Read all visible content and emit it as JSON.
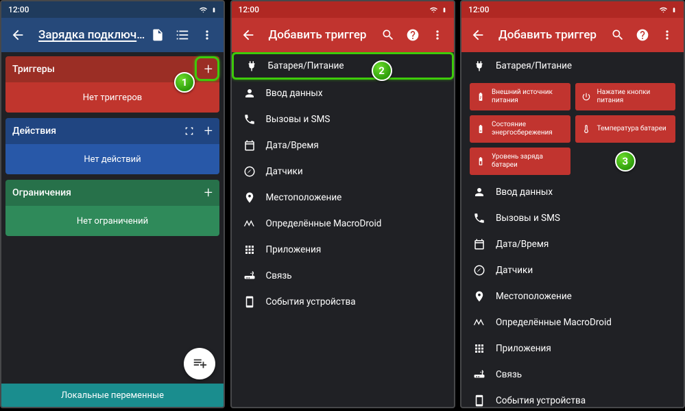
{
  "status": {
    "time": "12:00"
  },
  "screen1": {
    "title": "Зарядка подключена",
    "trig_label": "Триггеры",
    "trig_empty": "Нет триггеров",
    "act_label": "Действия",
    "act_empty": "Нет действий",
    "con_label": "Ограничения",
    "con_empty": "Нет ограничений",
    "bottom": "Локальные переменные",
    "marker": "1"
  },
  "screen2": {
    "title": "Добавить триггер",
    "marker": "2",
    "items": [
      "Батарея/Питание",
      "Ввод данных",
      "Вызовы и SMS",
      "Дата/Время",
      "Датчики",
      "Местоположение",
      "Определённые MacroDroid",
      "Приложения",
      "Связь",
      "События устройства"
    ]
  },
  "screen3": {
    "title": "Добавить триггер",
    "marker": "3",
    "expanded_header": "Батарея/Питание",
    "chips": [
      "Внешний источник питания",
      "Нажатие кнопки питания",
      "Состояние энергосбережения",
      "Температура батареи",
      "Уровень заряда батареи"
    ],
    "items": [
      "Ввод данных",
      "Вызовы и SMS",
      "Дата/Время",
      "Датчики",
      "Местоположение",
      "Определённые MacroDroid",
      "Приложения",
      "Связь",
      "События устройства"
    ]
  }
}
